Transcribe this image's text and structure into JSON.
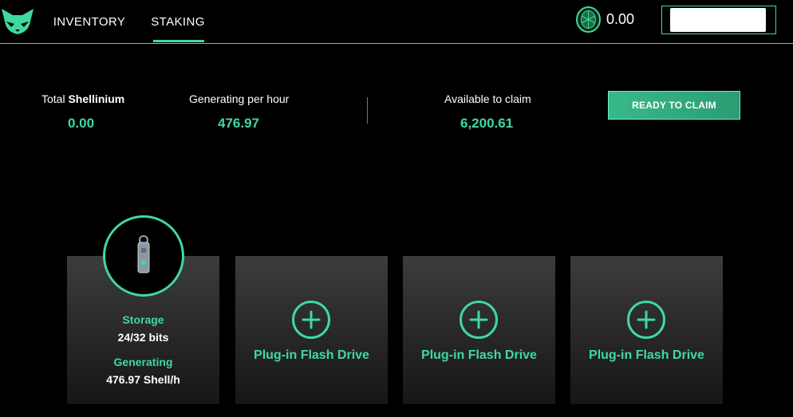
{
  "header": {
    "nav": [
      {
        "label": "INVENTORY",
        "active": false
      },
      {
        "label": "STAKING",
        "active": true
      }
    ],
    "balance": "0.00",
    "icons": {
      "logo": "cat-face-logo",
      "currency": "turtle-shell-coin-icon"
    }
  },
  "stats": {
    "total_prefix": "Total ",
    "total_name": "Shellinium",
    "total_value": "0.00",
    "generating_label": "Generating per hour",
    "generating_value": "476.97",
    "available_label": "Available to claim",
    "available_value": "6,200.61",
    "claim_button": "READY TO CLAIM"
  },
  "cards": {
    "storage": {
      "storage_label": "Storage",
      "storage_value": "24/32 bits",
      "generating_label": "Generating",
      "generating_value": "476.97 Shell/h",
      "icon": "flash-drive-icon"
    },
    "slots": [
      {
        "label": "Plug-in Flash Drive",
        "icon": "plus-circle-icon"
      },
      {
        "label": "Plug-in Flash Drive",
        "icon": "plus-circle-icon"
      },
      {
        "label": "Plug-in Flash Drive",
        "icon": "plus-circle-icon"
      }
    ]
  },
  "colors": {
    "accent": "#3fd9a0",
    "background": "#000000",
    "card": "#2e2e2e"
  }
}
